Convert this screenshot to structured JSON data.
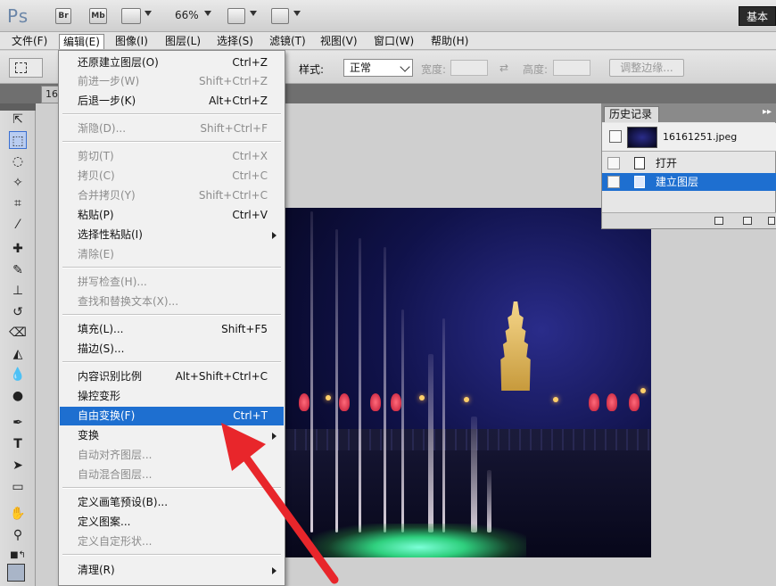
{
  "app": {
    "logo": "Ps",
    "bridge_label": "Br",
    "minibridge_label": "Mb",
    "zoom": "66%",
    "workspace": "基本"
  },
  "menubar": [
    {
      "label": "文件(F)"
    },
    {
      "label": "编辑(E)"
    },
    {
      "label": "图像(I)"
    },
    {
      "label": "图层(L)"
    },
    {
      "label": "选择(S)"
    },
    {
      "label": "滤镜(T)"
    },
    {
      "label": "视图(V)"
    },
    {
      "label": "窗口(W)"
    },
    {
      "label": "帮助(H)"
    }
  ],
  "options": {
    "style_label": "样式:",
    "style_value": "正常",
    "width_label": "宽度:",
    "height_label": "高度:",
    "refine_edge": "调整边缘..."
  },
  "document": {
    "tab_label": "16"
  },
  "edit_menu": {
    "items": [
      {
        "label": "还原建立图层(O)",
        "shortcut": "Ctrl+Z",
        "enabled": true
      },
      {
        "label": "前进一步(W)",
        "shortcut": "Shift+Ctrl+Z",
        "enabled": false
      },
      {
        "label": "后退一步(K)",
        "shortcut": "Alt+Ctrl+Z",
        "enabled": true
      },
      {
        "label": "渐隐(D)...",
        "shortcut": "Shift+Ctrl+F",
        "enabled": false
      },
      {
        "label": "剪切(T)",
        "shortcut": "Ctrl+X",
        "enabled": false
      },
      {
        "label": "拷贝(C)",
        "shortcut": "Ctrl+C",
        "enabled": false
      },
      {
        "label": "合并拷贝(Y)",
        "shortcut": "Shift+Ctrl+C",
        "enabled": false
      },
      {
        "label": "粘贴(P)",
        "shortcut": "Ctrl+V",
        "enabled": true
      },
      {
        "label": "选择性粘贴(I)",
        "shortcut": "",
        "enabled": true
      },
      {
        "label": "清除(E)",
        "shortcut": "",
        "enabled": false
      },
      {
        "label": "拼写检查(H)...",
        "shortcut": "",
        "enabled": false
      },
      {
        "label": "查找和替换文本(X)...",
        "shortcut": "",
        "enabled": false
      },
      {
        "label": "填充(L)...",
        "shortcut": "Shift+F5",
        "enabled": true
      },
      {
        "label": "描边(S)...",
        "shortcut": "",
        "enabled": true
      },
      {
        "label": "内容识别比例",
        "shortcut": "Alt+Shift+Ctrl+C",
        "enabled": true
      },
      {
        "label": "操控变形",
        "shortcut": "",
        "enabled": true
      },
      {
        "label": "自由变换(F)",
        "shortcut": "Ctrl+T",
        "enabled": true
      },
      {
        "label": "变换",
        "shortcut": "",
        "enabled": true
      },
      {
        "label": "自动对齐图层...",
        "shortcut": "",
        "enabled": false
      },
      {
        "label": "自动混合图层...",
        "shortcut": "",
        "enabled": false
      },
      {
        "label": "定义画笔预设(B)...",
        "shortcut": "",
        "enabled": true
      },
      {
        "label": "定义图案...",
        "shortcut": "",
        "enabled": true
      },
      {
        "label": "定义自定形状...",
        "shortcut": "",
        "enabled": false
      },
      {
        "label": "清理(R)",
        "shortcut": "",
        "enabled": true
      }
    ]
  },
  "history": {
    "title": "历史记录",
    "snapshot": "16161251.jpeg",
    "steps": [
      {
        "label": "打开"
      },
      {
        "label": "建立图层"
      }
    ]
  },
  "colors": {
    "highlight": "#1e6fd0",
    "arrow": "#e8262b"
  }
}
